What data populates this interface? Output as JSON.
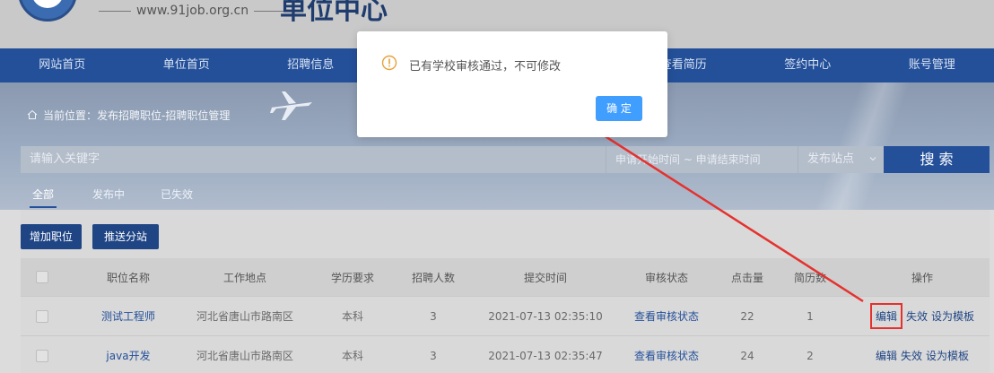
{
  "header": {
    "url": "www.91job.org.cn",
    "title": "单位中心"
  },
  "nav": {
    "items": [
      "网站首页",
      "单位首页",
      "招聘信息",
      "",
      "",
      "查看简历",
      "签约中心",
      "账号管理"
    ]
  },
  "banner": {
    "breadcrumb": "当前位置：发布招聘职位-招聘职位管理",
    "keyword_placeholder": "请输入关键字",
    "date_range": "申请开始时间 ~ 申请结束时间",
    "site_select": "发布站点",
    "search_label": "搜 索",
    "tabs": [
      "全部",
      "发布中",
      "已失效"
    ]
  },
  "actions": {
    "add_label": "增加职位",
    "push_label": "推送分站"
  },
  "table": {
    "headers": [
      "职位名称",
      "工作地点",
      "学历要求",
      "招聘人数",
      "提交时间",
      "审核状态",
      "点击量",
      "简历数",
      "操作"
    ],
    "rows": [
      {
        "name": "测试工程师",
        "location": "河北省唐山市路南区",
        "edu": "本科",
        "count": "3",
        "time": "2021-07-13 02:35:10",
        "status": "查看审核状态",
        "clicks": "22",
        "resumes": "1",
        "ops": [
          "编辑",
          "失效",
          "设为模板"
        ]
      },
      {
        "name": "java开发",
        "location": "河北省唐山市路南区",
        "edu": "本科",
        "count": "3",
        "time": "2021-07-13 02:35:47",
        "status": "查看审核状态",
        "clicks": "24",
        "resumes": "2",
        "ops": [
          "编辑",
          "失效",
          "设为模板"
        ]
      }
    ]
  },
  "dialog": {
    "message": "已有学校审核通过，不可修改",
    "ok_label": "确 定",
    "icon": "warning-icon"
  },
  "colors": {
    "primary": "#24509a",
    "dialog_button": "#409eff",
    "highlight": "#e5312e"
  }
}
